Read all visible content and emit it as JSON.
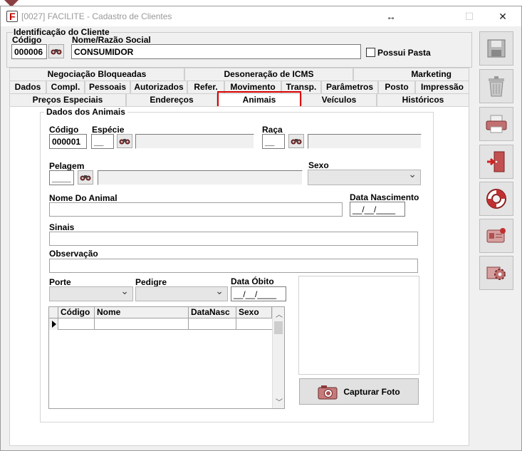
{
  "window": {
    "title": "[0027] FACILITE - Cadastro de Clientes",
    "resize_glyph": "↔",
    "maximize_glyph": "☐",
    "close_glyph": "✕"
  },
  "client": {
    "group_label": "Identificação do Cliente",
    "code_label": "Código",
    "code_value": "000006",
    "name_label": "Nome/Razão Social",
    "name_value": "CONSUMIDOR",
    "possui_pasta_label": "Possui Pasta"
  },
  "tabs": {
    "row1": [
      "Negociação Bloqueadas",
      "Desoneração de ICMS",
      "Marketing"
    ],
    "row2": [
      "Dados",
      "Compl.",
      "Pessoais",
      "Autorizados",
      "Refer.",
      "Movimento",
      "Transp.",
      "Parâmetros",
      "Posto",
      "Impressão"
    ],
    "row3": [
      "Preços Especiais",
      "Endereços",
      "Animais",
      "Veículos",
      "Históricos"
    ],
    "active": "Animais"
  },
  "animals": {
    "group_label": "Dados dos Animais",
    "codigo_label": "Código",
    "codigo_value": "000001",
    "especie_label": "Espécie",
    "especie_value": "__",
    "raca_label": "Raça",
    "raca_value": "__",
    "pelagem_label": "Pelagem",
    "pelagem_value": "____",
    "sexo_label": "Sexo",
    "nome_label": "Nome Do Animal",
    "data_nasc_label": "Data Nascimento",
    "data_nasc_value": "__/__/____",
    "sinais_label": "Sinais",
    "observacao_label": "Observação",
    "porte_label": "Porte",
    "pedigre_label": "Pedigre",
    "data_obito_label": "Data Óbito",
    "data_obito_value": "__/__/____",
    "grid_columns": [
      "Código",
      "Nome",
      "DataNasc",
      "Sexo"
    ],
    "capture_label": "Capturar Foto"
  },
  "sidebar": {
    "buttons": [
      "save-icon",
      "trash-icon",
      "print-icon",
      "exit-door-icon",
      "lifebuoy-icon",
      "id-card-icon",
      "settings-gear-icon"
    ]
  }
}
